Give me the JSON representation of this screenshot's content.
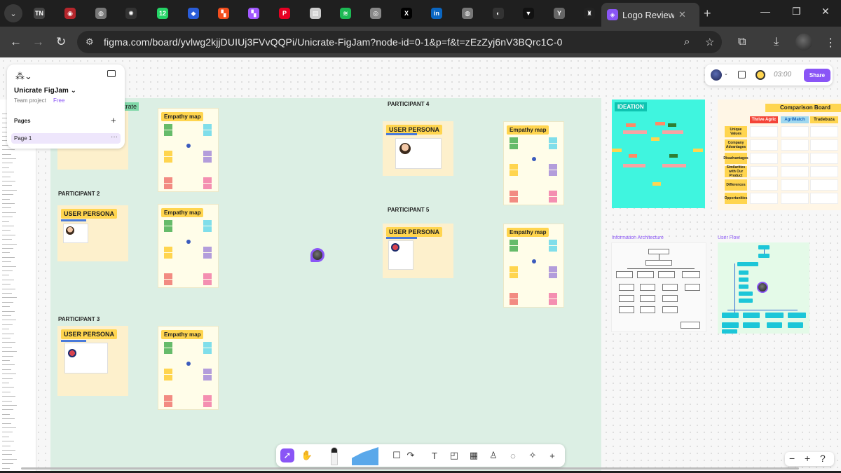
{
  "browser": {
    "active_tab_title": "Logo Review b",
    "url": "figma.com/board/yvlwg2kjjDUIUj3FVvQQPi/Unicrate-FigJam?node-id=0-1&p=f&t=zEzZyj6nV3BQrc1C-0",
    "tabs": [
      {
        "icon": "tn-icon",
        "glyph": "TN",
        "color": "#444444"
      },
      {
        "icon": "emblem-icon",
        "glyph": "◉",
        "color": "#b5262c"
      },
      {
        "icon": "globe-icon",
        "glyph": "◍",
        "color": "#777777"
      },
      {
        "icon": "openai-icon",
        "glyph": "✺",
        "color": "#333333"
      },
      {
        "icon": "whatsapp-icon",
        "glyph": "12",
        "color": "#25d366"
      },
      {
        "icon": "shield-app-icon",
        "glyph": "◆",
        "color": "#2a5dd9"
      },
      {
        "icon": "figma-icon",
        "glyph": "▚",
        "color": "#f24e1e"
      },
      {
        "icon": "figma-active-icon",
        "glyph": "▚",
        "color": "#a259ff"
      },
      {
        "icon": "pinterest-icon",
        "glyph": "P",
        "color": "#e60023"
      },
      {
        "icon": "docs-icon",
        "glyph": "▤",
        "color": "#cccccc"
      },
      {
        "icon": "spotify-icon",
        "glyph": "≋",
        "color": "#1db954"
      },
      {
        "icon": "instagram-icon",
        "glyph": "◎",
        "color": "#888888"
      },
      {
        "icon": "x-icon",
        "glyph": "X",
        "color": "#000000"
      },
      {
        "icon": "linkedin-icon",
        "glyph": "in",
        "color": "#0a66c2"
      },
      {
        "icon": "globe2-icon",
        "glyph": "◍",
        "color": "#777777"
      },
      {
        "icon": "eye-icon",
        "glyph": "◐",
        "color": "#333333"
      },
      {
        "icon": "framer-icon",
        "glyph": "▼",
        "color": "#111111"
      },
      {
        "icon": "y-icon",
        "glyph": "Y",
        "color": "#666666"
      },
      {
        "icon": "crest-icon",
        "glyph": "♜",
        "color": "#222222"
      }
    ]
  },
  "figma": {
    "file_name": "Unicrate FigJam",
    "team_label": "Team project",
    "plan_label": "Free",
    "pages_heading": "Pages",
    "page_name": "Page 1",
    "section_label": "crate",
    "timer": "03:00",
    "share_label": "Share",
    "accent": "#8a55f6"
  },
  "board": {
    "participants": {
      "p2": "PARTICIPANT 2",
      "p3": "PARTICIPANT 3",
      "p4": "PARTICIPANT 4",
      "p5": "PARTICIPANT 5"
    },
    "user_persona_label": "USER PERSONA",
    "empathy_map_label": "Empathy map",
    "ideation_label": "IDEATION",
    "comparison": {
      "title": "Comparison Board",
      "columns": [
        "Thrive Agric",
        "AgriMatch",
        "Tradebuza"
      ],
      "rows": [
        "Unique Values",
        "Company Advantages",
        "Disadvantages",
        "Similarities with Our Product",
        "Differences",
        "Opportunities"
      ]
    },
    "ia_label": "Information Architecture",
    "userflow_label": "User Flow"
  }
}
